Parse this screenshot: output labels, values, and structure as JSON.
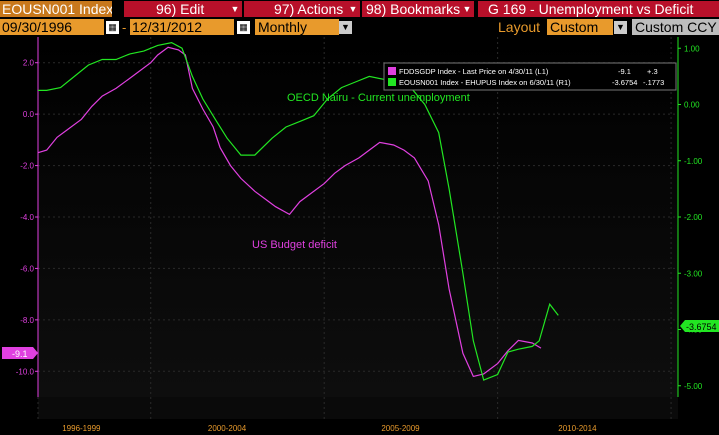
{
  "toolbar": {
    "ticker": "EOUSN001 Index",
    "edit": "96) Edit",
    "actions": "97) Actions",
    "bookmarks": "98) Bookmarks",
    "title": "G 169 - Unemployment vs Deficit"
  },
  "controls": {
    "start_date": "09/30/1996",
    "end_date": "12/31/2012",
    "frequency": "Monthly",
    "layout_label": "Layout",
    "layout_value": "Custom",
    "currency": "Custom CCY"
  },
  "colors": {
    "magenta": "#e040e0",
    "green": "#22e622",
    "orange": "#e89a2c",
    "red": "#b8102a"
  },
  "chart_data": {
    "type": "line",
    "legend": {
      "placement": "top-right",
      "row1": "FDDSGDP Index - Last Price on 4/30/11 (L1)",
      "row1_value": "-9.1",
      "row1_change": "+.3",
      "row2": "EOUSN001 Index - EHUPUS Index on 6/30/11 (R1)",
      "row2_value": "-3.6754",
      "row2_change": "-.1773"
    },
    "annotations": [
      "OECD Nairu - Current unemployment",
      "US Budget deficit"
    ],
    "x_ticks": [
      "1996-1999",
      "2000-2004",
      "2005-2009",
      "2010-2014"
    ],
    "xlim": [
      1996.75,
      2015.2
    ],
    "left_axis": {
      "ticks": [
        "2.0",
        "0.0",
        "-2.0",
        "-4.0",
        "-6.0",
        "-8.0",
        "-10.0"
      ],
      "tick_values": [
        2,
        0,
        -2,
        -4,
        -6,
        -8,
        -10
      ],
      "ylim": [
        -11,
        3
      ]
    },
    "right_axis": {
      "ticks": [
        "1.00",
        "0.00",
        "-1.00",
        "-2.00",
        "-3.00",
        "-4.00",
        "-5.00"
      ],
      "tick_values": [
        1,
        0,
        -1,
        -2,
        -3,
        -4,
        -5
      ],
      "ylim": [
        -5.2,
        1.2
      ]
    },
    "left_flag": "-9.1",
    "right_flag": "-3.6754",
    "series": [
      {
        "name": "FDDSGDP Index",
        "axis": "left",
        "color": "#e040e0",
        "x": [
          1996.75,
          1997.0,
          1997.3,
          1997.6,
          1998.0,
          1998.3,
          1998.6,
          1999.0,
          1999.3,
          1999.6,
          2000.0,
          2000.2,
          2000.5,
          2000.8,
          2001.0,
          2001.2,
          2001.5,
          2001.8,
          2002.0,
          2002.3,
          2002.6,
          2003.0,
          2003.3,
          2003.6,
          2004.0,
          2004.3,
          2004.6,
          2005.0,
          2005.3,
          2005.6,
          2006.0,
          2006.3,
          2006.6,
          2007.0,
          2007.3,
          2007.6,
          2008.0,
          2008.3,
          2008.6,
          2009.0,
          2009.3,
          2009.6,
          2010.0,
          2010.3,
          2010.6,
          2011.0,
          2011.25
        ],
        "y": [
          -1.5,
          -1.4,
          -0.9,
          -0.6,
          -0.2,
          0.3,
          0.7,
          1.0,
          1.3,
          1.6,
          2.0,
          2.3,
          2.6,
          2.5,
          2.3,
          1.0,
          0.2,
          -0.5,
          -1.3,
          -2.0,
          -2.5,
          -3.0,
          -3.3,
          -3.6,
          -3.9,
          -3.4,
          -3.1,
          -2.7,
          -2.3,
          -2.0,
          -1.7,
          -1.4,
          -1.1,
          -1.2,
          -1.4,
          -1.7,
          -2.6,
          -4.3,
          -6.8,
          -9.3,
          -10.2,
          -10.1,
          -9.7,
          -9.2,
          -8.8,
          -8.9,
          -9.1
        ]
      },
      {
        "name": "EOUSN001 Index",
        "axis": "right",
        "color": "#22e622",
        "x": [
          1996.75,
          1997.0,
          1997.4,
          1997.8,
          1998.2,
          1998.6,
          1999.0,
          1999.4,
          1999.8,
          2000.2,
          2000.6,
          2000.9,
          2001.2,
          2001.5,
          2001.9,
          2002.2,
          2002.6,
          2003.0,
          2003.5,
          2003.9,
          2004.3,
          2004.7,
          2005.1,
          2005.5,
          2005.9,
          2006.3,
          2006.7,
          2007.1,
          2007.5,
          2007.9,
          2008.3,
          2008.6,
          2009.0,
          2009.3,
          2009.6,
          2010.0,
          2010.3,
          2010.6,
          2011.0,
          2011.2,
          2011.5,
          2011.75
        ],
        "y": [
          0.25,
          0.25,
          0.3,
          0.5,
          0.7,
          0.8,
          0.8,
          0.9,
          0.95,
          1.05,
          1.1,
          1.0,
          0.5,
          0.1,
          -0.3,
          -0.6,
          -0.9,
          -0.9,
          -0.6,
          -0.4,
          -0.3,
          -0.2,
          0.1,
          0.3,
          0.4,
          0.5,
          0.45,
          0.4,
          0.3,
          0.0,
          -0.5,
          -1.5,
          -3.0,
          -4.2,
          -4.9,
          -4.8,
          -4.4,
          -4.35,
          -4.3,
          -4.2,
          -3.55,
          -3.75
        ]
      }
    ]
  }
}
